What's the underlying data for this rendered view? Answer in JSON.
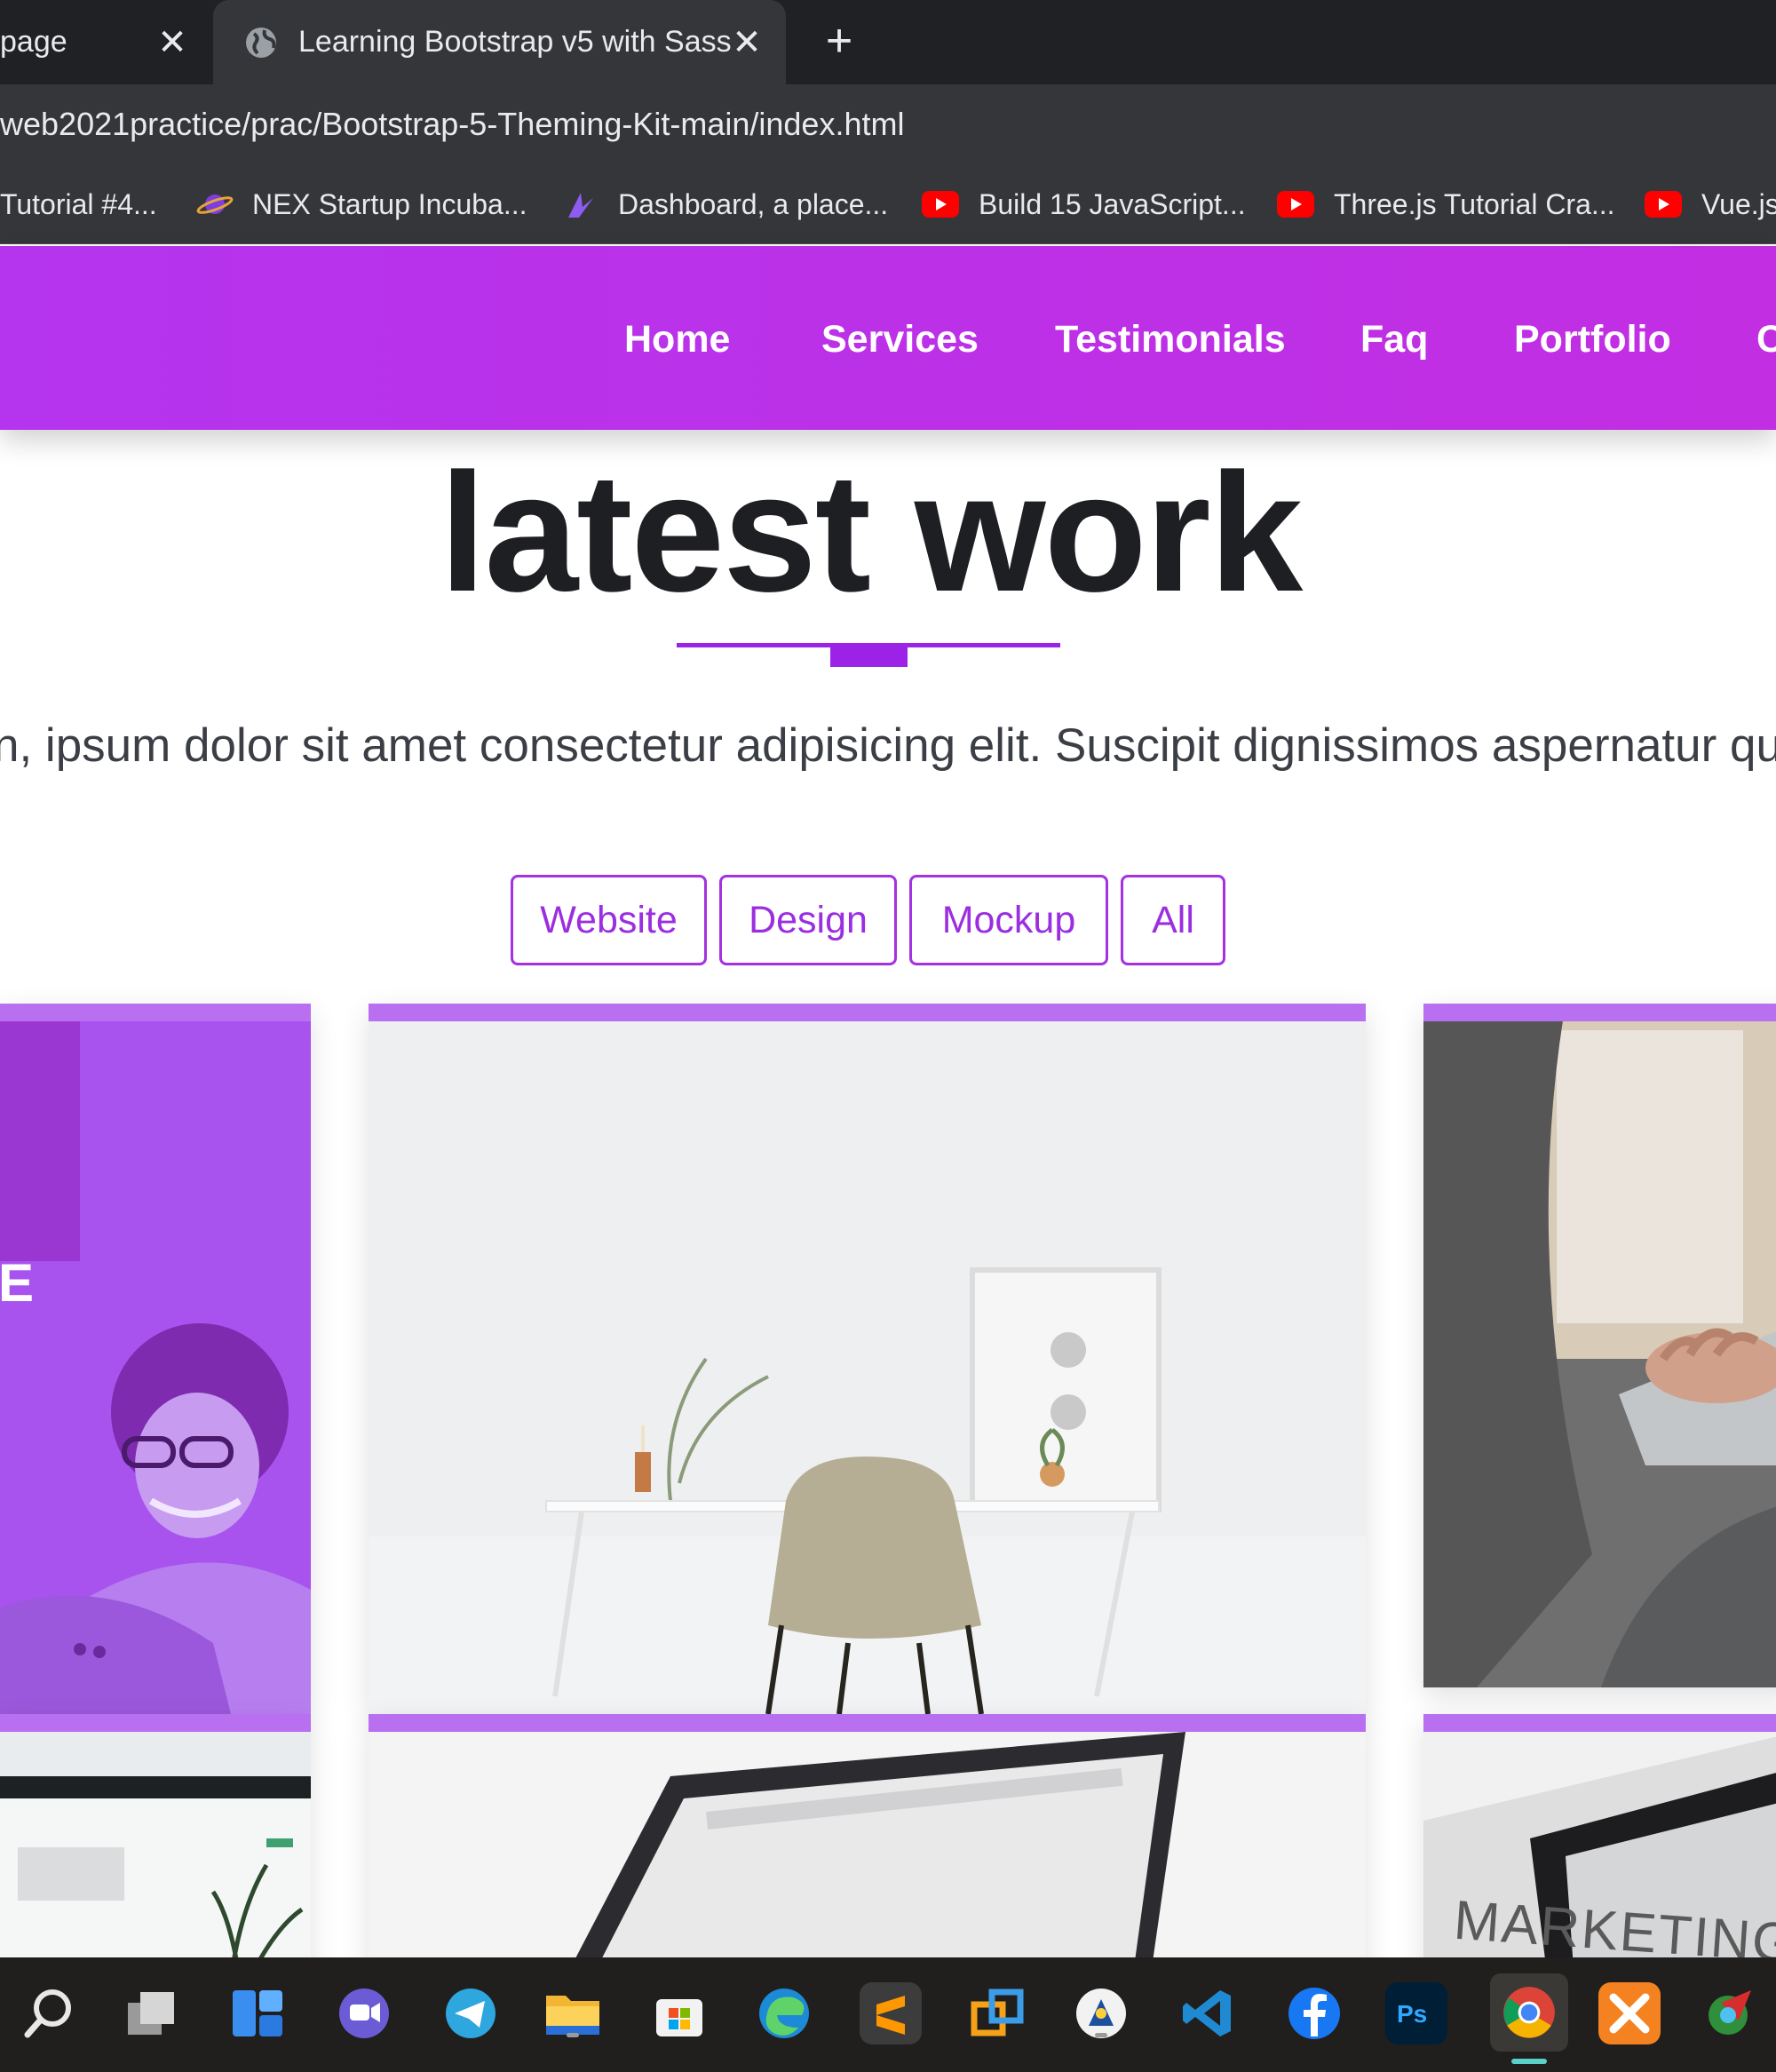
{
  "browser": {
    "tabs": [
      {
        "label": "page"
      },
      {
        "label": "Learning Bootstrap v5 with Sass"
      }
    ],
    "new_tab_label": "+",
    "close_glyph": "✕",
    "url": "web2021practice/prac/Bootstrap-5-Theming-Kit-main/index.html",
    "bookmarks": [
      {
        "label": "Tutorial #4...",
        "icon": "none"
      },
      {
        "label": "NEX Startup Incuba...",
        "icon": "planet-icon"
      },
      {
        "label": "Dashboard, a place...",
        "icon": "feather-icon"
      },
      {
        "label": "Build 15 JavaScript...",
        "icon": "youtube-icon"
      },
      {
        "label": "Three.js Tutorial Cra...",
        "icon": "youtube-icon"
      },
      {
        "label": "Vue.js",
        "icon": "youtube-icon"
      }
    ]
  },
  "navbar": {
    "links": [
      "Home",
      "Services",
      "Testimonials",
      "Faq",
      "Portfolio",
      "C"
    ]
  },
  "section": {
    "title": "latest work",
    "lead": "n, ipsum dolor sit amet consectetur adipisicing elit. Suscipit dignissimos aspernatur quod r",
    "filters": [
      "Website",
      "Design",
      "Mockup",
      "All"
    ],
    "card_overlay_text": "E",
    "card_marketing_text": "MARKETING"
  },
  "colors": {
    "brand_purple": "#b534ee",
    "accent_purple": "#9d22e8",
    "card_top_bar": "#b86ff0"
  },
  "taskbar": {
    "icons": [
      "search-icon",
      "task-view-icon",
      "widgets-icon",
      "teams-chat-icon",
      "telegram-icon",
      "file-explorer-icon",
      "microsoft-store-icon",
      "edge-icon",
      "sublime-text-icon",
      "virtual-desktop-icon",
      "inkscape-icon",
      "vscode-icon",
      "facebook-icon",
      "photoshop-icon",
      "chrome-icon",
      "xampp-icon",
      "network-tool-icon"
    ]
  }
}
